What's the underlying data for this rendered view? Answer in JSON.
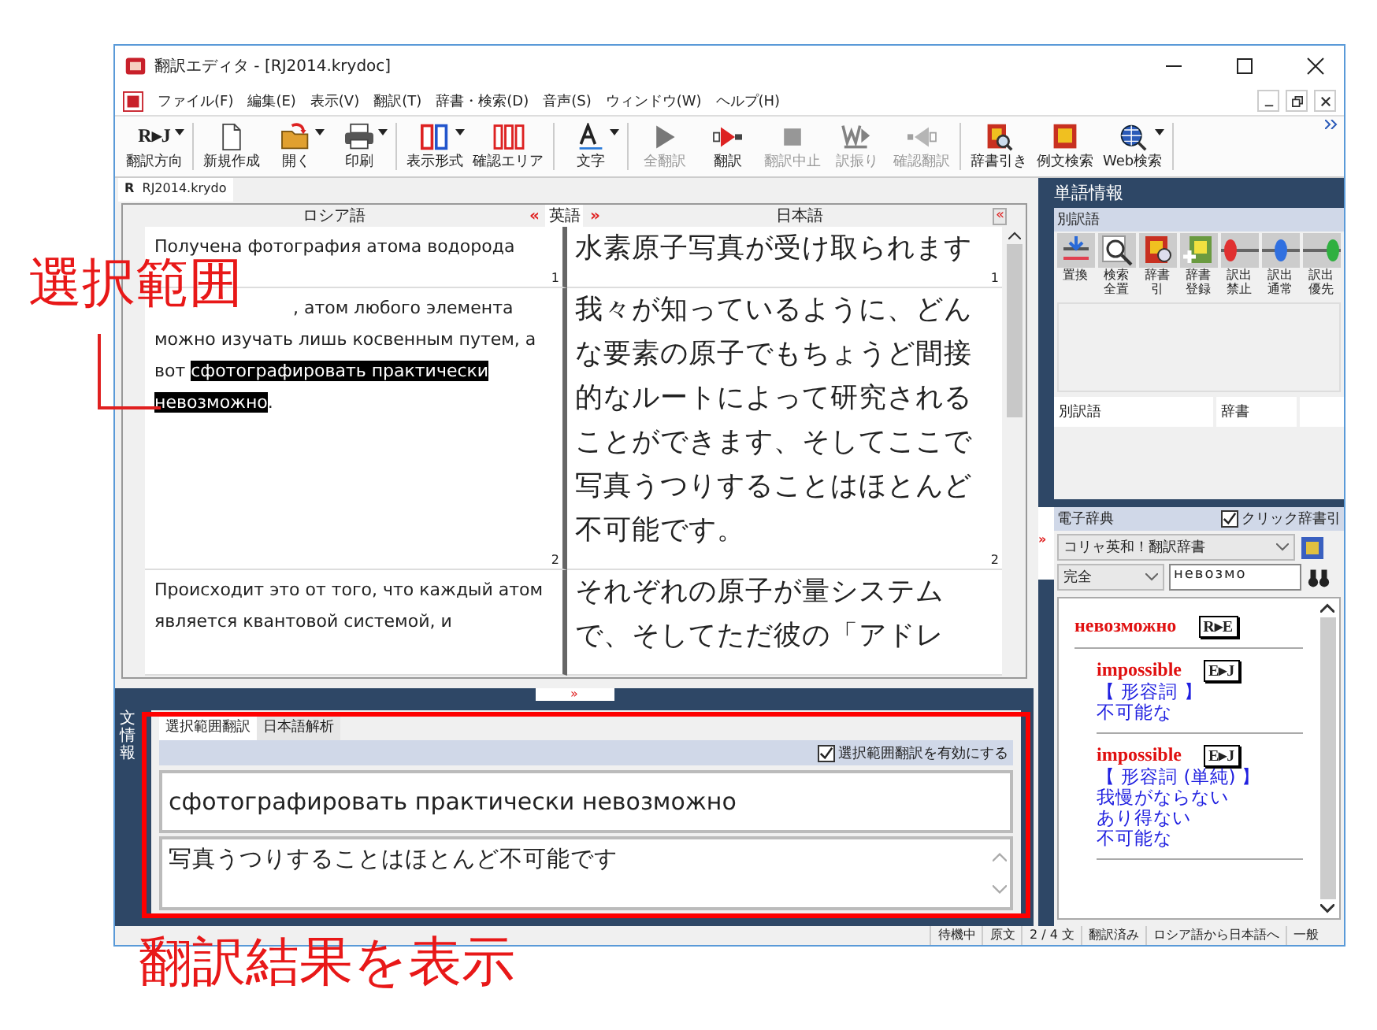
{
  "window": {
    "title": "翻訳エディタ - [RJ2014.krydoc]"
  },
  "menu": [
    "ファイル(F)",
    "編集(E)",
    "表示(V)",
    "翻訳(T)",
    "辞書・検索(D)",
    "音声(S)",
    "ウィンドウ(W)",
    "ヘルプ(H)"
  ],
  "toolbar": {
    "groups": [
      [
        {
          "label": "翻訳方向",
          "icon_text": "R▸J",
          "caret": true,
          "disabled": false
        }
      ],
      [
        {
          "label": "新規作成",
          "caret": false,
          "disabled": false
        },
        {
          "label": "開く",
          "caret": true,
          "disabled": false
        },
        {
          "label": "印刷",
          "caret": true,
          "disabled": false
        }
      ],
      [
        {
          "label": "表示形式",
          "caret": true,
          "disabled": false
        },
        {
          "label": "確認エリア",
          "caret": false,
          "disabled": false
        }
      ],
      [
        {
          "label": "文字",
          "caret": true,
          "disabled": false
        }
      ],
      [
        {
          "label": "全翻訳",
          "caret": false,
          "disabled": true
        },
        {
          "label": "翻訳",
          "caret": false,
          "disabled": false
        },
        {
          "label": "翻訳中止",
          "caret": false,
          "disabled": true
        },
        {
          "label": "訳振り",
          "caret": false,
          "disabled": true
        },
        {
          "label": "確認翻訳",
          "caret": false,
          "disabled": true
        }
      ],
      [
        {
          "label": "辞書引き",
          "caret": false,
          "disabled": false
        },
        {
          "label": "例文検索",
          "caret": false,
          "disabled": false
        },
        {
          "label": "Web検索",
          "caret": true,
          "disabled": false
        }
      ]
    ]
  },
  "document": {
    "tab": {
      "badge": "R",
      "label": "RJ2014.krydo"
    },
    "header": {
      "source": "ロシア語",
      "left_arrow": "«",
      "middle": "英語",
      "right_arrow": "»",
      "target": "日本語",
      "collapse": "«"
    },
    "rows": [
      {
        "source_number": "1",
        "target_number": "1",
        "source": [
          {
            "text": "Получена фотография атома водорода",
            "selected": false
          }
        ],
        "target": "水素原子写真が受け取られます"
      },
      {
        "source_number": "2",
        "target_number": "2",
        "source": [
          {
            "text": ", атом любого элемента можно изучать лишь косвенным путем, а вот ",
            "selected": false
          },
          {
            "text": "сфотографировать практически невозможно",
            "selected": true
          },
          {
            "text": ".",
            "selected": false
          }
        ],
        "target": "我々が知っているように、どんな要素の原子でもちょうど間接的なルートによって研究されることができます、そしてここで写真うつりすることはほとんど不可能です。"
      },
      {
        "source": [
          {
            "text": "Происходит это от того, что каждый атом является квантовой системой, и",
            "selected": false
          }
        ],
        "target": "それぞれの原子が量システムで、そしてただ彼の「アドレ"
      }
    ]
  },
  "splitter": {
    "arrow": "»"
  },
  "sentence_panel": {
    "side_label": "文情報",
    "tabs": [
      {
        "label": "選択範囲翻訳",
        "selected": true
      },
      {
        "label": "日本語解析",
        "selected": false
      }
    ],
    "enable": {
      "label": "選択範囲翻訳を有効にする",
      "checked": true
    },
    "source": "сфотографировать практически невозможно",
    "result": "写真うつりすることはほとんど不可能です"
  },
  "word_panel": {
    "title": "単語情報",
    "alt_header": "別訳語",
    "tools": [
      {
        "label": "置換",
        "kind": "replace"
      },
      {
        "label": "検索全置",
        "kind": "search"
      },
      {
        "label": "辞書引",
        "kind": "dict"
      },
      {
        "label": "辞書登録",
        "kind": "register"
      },
      {
        "label": "訳出禁止",
        "kind": "red"
      },
      {
        "label": "訳出通常",
        "kind": "blue"
      },
      {
        "label": "訳出優先",
        "kind": "green"
      }
    ],
    "list_columns": [
      "別訳語",
      "辞書"
    ],
    "expand": "»",
    "dictionary": {
      "title": "電子辞典",
      "click_lookup": {
        "label": "クリック辞書引",
        "checked": true
      },
      "dictionary_select": "コリャ英和！翻訳辞書",
      "mode_select": "完全",
      "query": "невозмо",
      "entries": [
        {
          "headword": "невозможно",
          "tag": "R▸E",
          "children": [
            {
              "headword": "impossible",
              "tag": "E▸J",
              "pos": "【 形容詞 】",
              "senses": [
                "不可能な"
              ]
            },
            {
              "headword": "impossible",
              "tag": "E▸J",
              "pos": "【 形容詞 (単純) 】",
              "senses": [
                "我慢がならない",
                "あり得ない",
                "不可能な"
              ]
            }
          ]
        }
      ]
    }
  },
  "status_bar": [
    "待機中",
    "原文",
    "2 / 4 文",
    "翻訳済み",
    "ロシア語から日本語へ",
    "一般"
  ],
  "callouts": {
    "selection": "選択範囲",
    "result": "翻訳結果を表示"
  }
}
